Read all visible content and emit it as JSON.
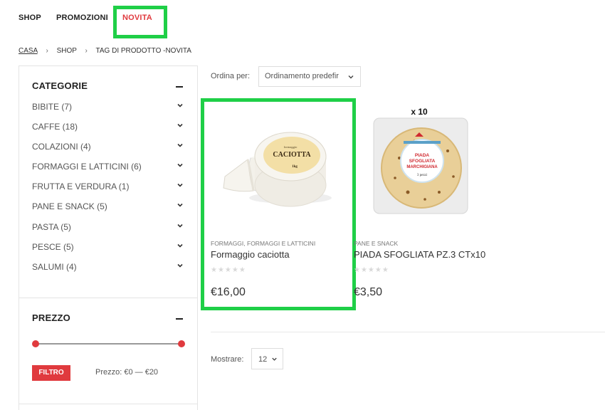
{
  "nav": {
    "shop": "SHOP",
    "promozioni": "PROMOZIONI",
    "novita": "NOVITA"
  },
  "breadcrumb": {
    "home": "CASA",
    "shop": "SHOP",
    "current": "TAG DI PRODOTTO -NOVITA"
  },
  "sidebar": {
    "categories_title": "CATEGORIE",
    "categories": [
      {
        "label": "BIBITE (7)"
      },
      {
        "label": "CAFFE (18)"
      },
      {
        "label": "COLAZIONI (4)"
      },
      {
        "label": "FORMAGGI E LATTICINI (6)"
      },
      {
        "label": "FRUTTA E VERDURA (1)"
      },
      {
        "label": "PANE E SNACK (5)"
      },
      {
        "label": "PASTA (5)"
      },
      {
        "label": "PESCE (5)"
      },
      {
        "label": "SALUMI (4)"
      }
    ],
    "price_title": "PREZZO",
    "filter_button": "FILTRO",
    "price_range": "Prezzo: €0 — €20"
  },
  "toolbar": {
    "sort_label": "Ordina per:",
    "sort_value": "Ordinamento predefir",
    "show_label": "Mostrare:",
    "show_value": "12"
  },
  "products": [
    {
      "category": "FORMAGGI, FORMAGGI E LATTICINI",
      "name": "Formaggio caciotta",
      "price": "€16,00",
      "rating": 0,
      "image_text": {
        "small": "formaggio",
        "main": "CACIOTTA",
        "weight": "1kg"
      }
    },
    {
      "category": "PANE E SNACK",
      "name": "PIADA SFOGLIATA PZ.3 CTx10",
      "price": "€3,50",
      "rating": 0,
      "image_text": {
        "qty": "x 10",
        "line1": "PIADA",
        "line2": "SFOGLIATA",
        "line3": "MARCHIGIANA",
        "pieces": "3 pezzi"
      }
    }
  ],
  "colors": {
    "accent": "#e03a3e",
    "highlight": "#1fcf47"
  }
}
